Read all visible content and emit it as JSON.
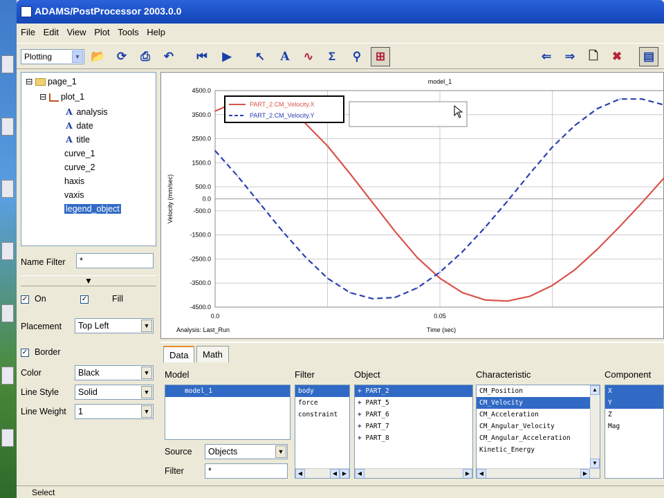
{
  "window": {
    "title": "ADAMS/PostProcessor 2003.0.0"
  },
  "menu": [
    "File",
    "Edit",
    "View",
    "Plot",
    "Tools",
    "Help"
  ],
  "toolbar": {
    "mode": "Plotting"
  },
  "tree": {
    "page": "page_1",
    "plot": "plot_1",
    "children": [
      "analysis",
      "date",
      "title",
      "curve_1",
      "curve_2",
      "haxis",
      "vaxis",
      "legend_object"
    ],
    "selected": "legend_object"
  },
  "props": {
    "name_filter_label": "Name Filter",
    "name_filter_value": "*",
    "on_label": "On",
    "fill_label": "Fill",
    "placement_label": "Placement",
    "placement_value": "Top Left",
    "border_label": "Border",
    "color_label": "Color",
    "color_value": "Black",
    "line_style_label": "Line Style",
    "line_style_value": "Solid",
    "line_weight_label": "Line Weight",
    "line_weight_value": "1"
  },
  "chart_data": {
    "type": "line",
    "title": "model_1",
    "xlabel": "Time (sec)",
    "ylabel": "Velocity (mm/sec)",
    "xlim": [
      0.0,
      0.1
    ],
    "ylim": [
      -4500.0,
      4500.0
    ],
    "x_ticks": [
      "0.0",
      "0.05"
    ],
    "y_ticks": [
      "4500.0",
      "3500.0",
      "2500.0",
      "1500.0",
      "500.0",
      "0.0",
      "-500.0",
      "-1500.0",
      "-2500.0",
      "-3500.0",
      "-4500.0"
    ],
    "analysis_label": "Analysis:  Last_Run",
    "legend_position": "top-left",
    "series": [
      {
        "name": "PART_2.CM_Velocity.X",
        "color": "#d9534a",
        "style": "solid",
        "x": [
          0.0,
          0.005,
          0.01,
          0.015,
          0.02,
          0.025,
          0.03,
          0.035,
          0.04,
          0.045,
          0.05,
          0.055,
          0.06,
          0.065,
          0.07,
          0.075,
          0.08,
          0.085,
          0.09,
          0.095,
          0.1
        ],
        "y": [
          3650,
          4050,
          4100,
          3800,
          3150,
          2200,
          1050,
          -150,
          -1350,
          -2450,
          -3300,
          -3900,
          -4200,
          -4250,
          -4050,
          -3600,
          -2950,
          -2100,
          -1150,
          -150,
          900
        ]
      },
      {
        "name": "PART_2.CM_Velocity.Y",
        "color": "#2a3fb0",
        "style": "dashed",
        "x": [
          0.0,
          0.005,
          0.01,
          0.015,
          0.02,
          0.025,
          0.03,
          0.035,
          0.04,
          0.045,
          0.05,
          0.055,
          0.06,
          0.065,
          0.07,
          0.075,
          0.08,
          0.085,
          0.09,
          0.095,
          0.1
        ],
        "y": [
          2000,
          950,
          -200,
          -1350,
          -2400,
          -3300,
          -3900,
          -4150,
          -4100,
          -3700,
          -3050,
          -2200,
          -1200,
          -100,
          1050,
          2150,
          3050,
          3750,
          4150,
          4150,
          3900
        ]
      }
    ]
  },
  "bottom": {
    "tabs": [
      "Data",
      "Math"
    ],
    "model_header": "Model",
    "models": [
      "model_1"
    ],
    "source_label": "Source",
    "source_value": "Objects",
    "filter_label": "Filter",
    "filter_value": "*",
    "filter_header": "Filter",
    "filters": [
      "body",
      "force",
      "constraint"
    ],
    "object_header": "Object",
    "objects": [
      "+ PART_2",
      "+ PART_5",
      "+ PART_6",
      "+ PART_7",
      "+ PART_8"
    ],
    "characteristic_header": "Characteristic",
    "characteristics": [
      "CM_Position",
      "CM_Velocity",
      "CM_Acceleration",
      "CM_Angular_Velocity",
      "CM_Angular_Acceleration",
      "Kinetic_Energy"
    ],
    "component_header": "Component",
    "components": [
      "X",
      "Y",
      "Z",
      "Mag"
    ]
  },
  "status": {
    "text": "Select"
  }
}
